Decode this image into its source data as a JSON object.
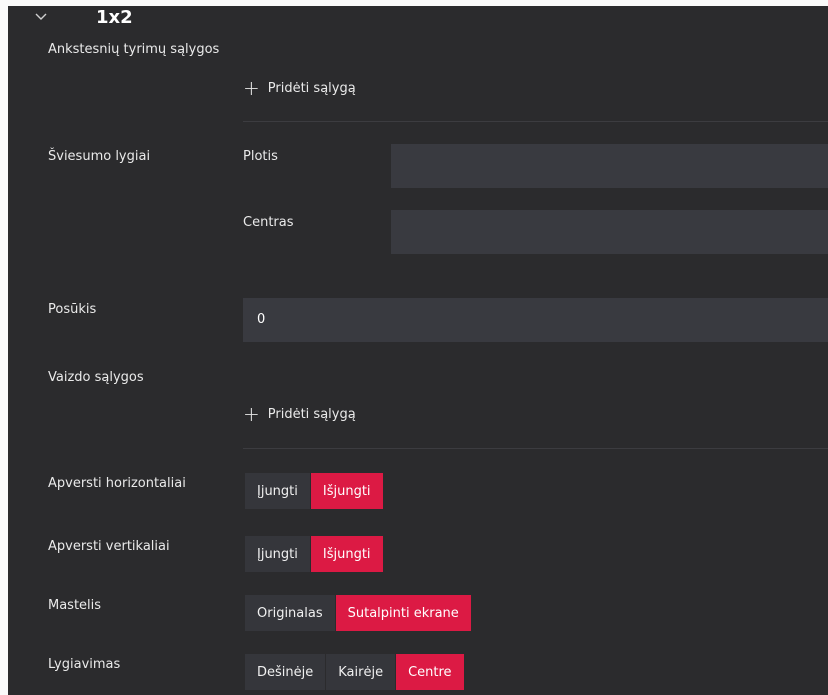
{
  "header": {
    "chevron": "chevron-down-icon",
    "title": "1x2"
  },
  "sections": {
    "prev_conditions": {
      "label": "Ankstesnių tyrimų sąlygos",
      "add_label": "Pridėti sąlygą"
    },
    "light_levels": {
      "label": "Šviesumo lygiai",
      "width_label": "Plotis",
      "width_value": "",
      "center_label": "Centras",
      "center_value": ""
    },
    "rotation": {
      "label": "Posūkis",
      "value": "0"
    },
    "image_conditions": {
      "label": "Vaizdo sąlygos",
      "add_label": "Pridėti sąlygą"
    },
    "flip_h": {
      "label": "Apversti horizontaliai",
      "on": "Įjungti",
      "off": "Išjungti",
      "selected": "off"
    },
    "flip_v": {
      "label": "Apversti vertikaliai",
      "on": "Įjungti",
      "off": "Išjungti",
      "selected": "off"
    },
    "scale": {
      "label": "Mastelis",
      "original": "Originalas",
      "fit": "Sutalpinti ekrane",
      "selected": "fit"
    },
    "align": {
      "label": "Lygiavimas",
      "right": "Dešinėje",
      "left": "Kairėje",
      "center": "Centre",
      "selected": "center"
    }
  },
  "colors": {
    "panel_bg": "#2b2b2d",
    "input_bg": "#393a40",
    "button_bg": "#35363b",
    "accent": "#dc1a44"
  }
}
